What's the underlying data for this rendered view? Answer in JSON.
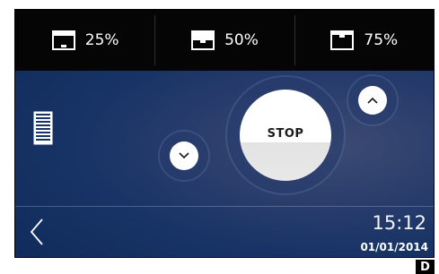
{
  "presets": [
    {
      "label": "25%",
      "icon": "blind-25-icon"
    },
    {
      "label": "50%",
      "icon": "blind-50-icon"
    },
    {
      "label": "75%",
      "icon": "blind-75-icon"
    }
  ],
  "controls": {
    "stop_label": "STOP",
    "up_icon": "chevron-up-icon",
    "down_icon": "chevron-down-icon",
    "list_icon": "blind-list-icon"
  },
  "footer": {
    "back_icon": "chevron-left-icon",
    "time": "15:12",
    "date": "01/01/2014"
  },
  "corner_label": "D",
  "colors": {
    "topbar": "#050505",
    "background": "#183466",
    "button": "#ffffff",
    "text": "#ffffff"
  }
}
